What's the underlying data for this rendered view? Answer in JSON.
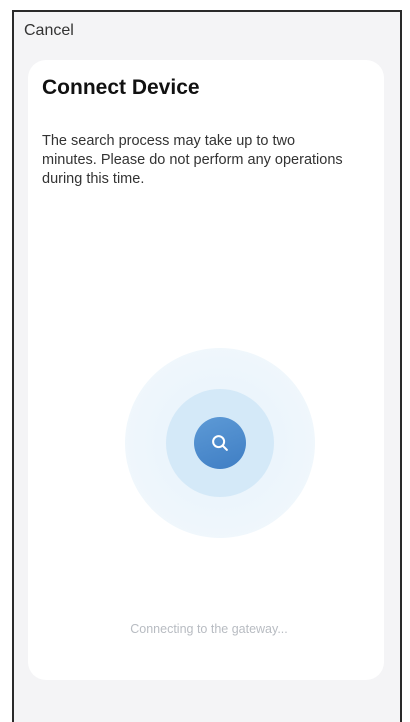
{
  "header": {
    "cancel_label": "Cancel"
  },
  "main": {
    "title": "Connect Device",
    "description": "The search process may take up to two minutes. Please do not perform any operations during this time.",
    "status": "Connecting to the gateway..."
  },
  "icons": {
    "center": "search-icon"
  },
  "colors": {
    "accent": "#4a8acb",
    "ring_inner": "#d4e9f8",
    "ring_outer": "#e9f3fb",
    "background": "#f4f4f6",
    "card": "#ffffff"
  }
}
